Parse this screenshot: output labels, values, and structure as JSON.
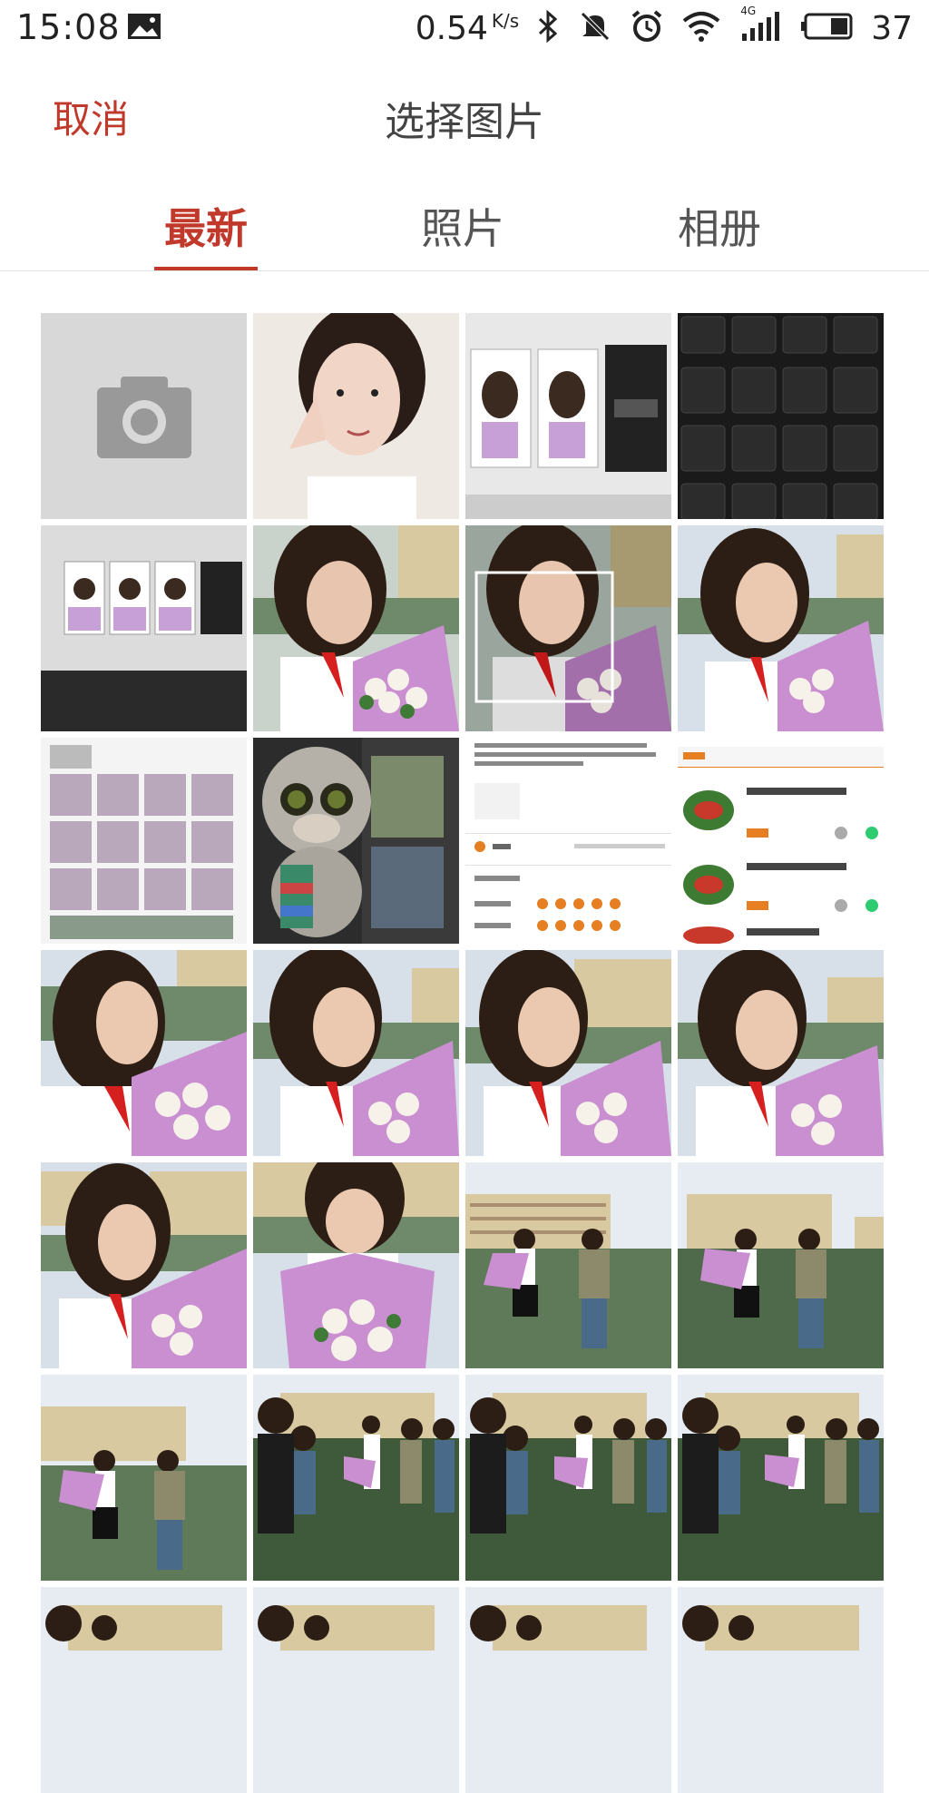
{
  "status_bar": {
    "time": "15:08",
    "network_speed": "0.54",
    "speed_unit": "K/s",
    "signal_label": "4G",
    "battery_level": "37",
    "icons": [
      "photo-notification-icon",
      "bluetooth-icon",
      "mute-icon",
      "alarm-icon",
      "wifi-icon",
      "signal-icon",
      "battery-icon"
    ]
  },
  "header": {
    "cancel_label": "取消",
    "title": "选择图片"
  },
  "tabs": [
    {
      "label": "最新",
      "active": true
    },
    {
      "label": "照片",
      "active": false
    },
    {
      "label": "相册",
      "active": false
    }
  ],
  "colors": {
    "accent": "#c0392b",
    "camera_tile": "#d8d8d8"
  },
  "grid": {
    "first_tile": "camera-icon",
    "thumbnails": [
      "selfie-peace-sign",
      "screenshot-monitor",
      "keyboard-closeup",
      "monitor-screenshots",
      "girl-flowers-1",
      "girl-flowers-crop",
      "girl-flowers-2",
      "collage-screenshot",
      "plush-monkey",
      "review-screenshot",
      "food-menu-screenshot",
      "girl-flowers-3",
      "girl-flowers-4",
      "girl-flowers-5",
      "girl-flowers-6",
      "girl-flowers-7",
      "girl-flowers-8",
      "two-girls-1",
      "two-girls-2",
      "two-girls-3",
      "group-dance-1",
      "group-dance-2",
      "group-dance-3",
      "group-4",
      "group-5",
      "group-6",
      "group-7"
    ]
  }
}
